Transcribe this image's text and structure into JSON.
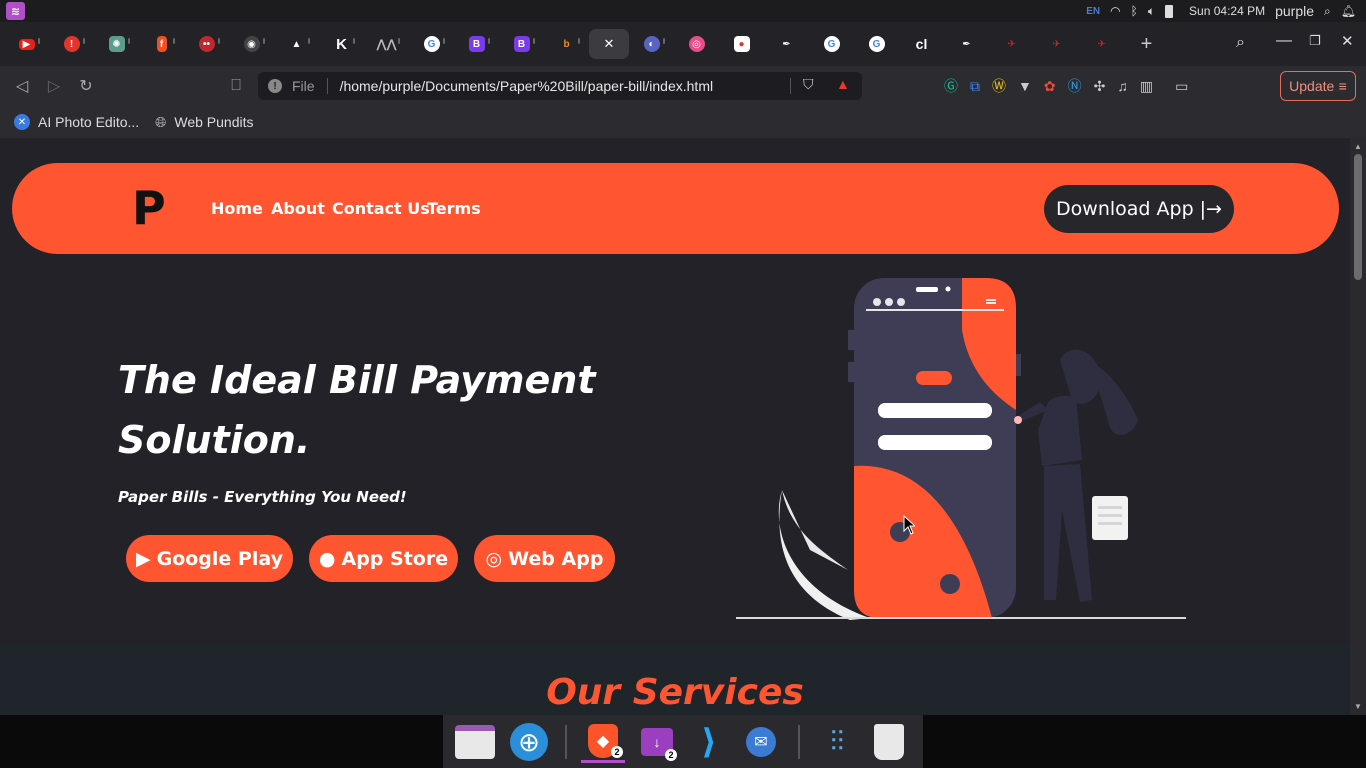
{
  "system": {
    "lang": "EN",
    "datetime": "Sun 04:24 PM",
    "user": "purple"
  },
  "browser": {
    "url_scheme_label": "File",
    "url": "/home/purple/Documents/Paper%20Bill/paper-bill/index.html",
    "update_label": "Update",
    "bookmarks": [
      {
        "label": "AI Photo Edito..."
      },
      {
        "label": "Web Pundits"
      }
    ]
  },
  "site": {
    "logo": "P",
    "nav": [
      "Home",
      "About",
      "Contact Us",
      "Terms"
    ],
    "download_label": "Download App",
    "hero_title": "The Ideal Bill Payment Solution.",
    "hero_subtitle": "Paper Bills - Everything You Need!",
    "store_buttons": [
      "Google Play",
      "App Store",
      "Web App"
    ],
    "services_title": "Our Services"
  },
  "taskbar": {
    "badges": [
      "2",
      "2"
    ]
  },
  "colors": {
    "accent": "#ff5631",
    "dark": "#26262b",
    "page_bg": "#222228"
  }
}
